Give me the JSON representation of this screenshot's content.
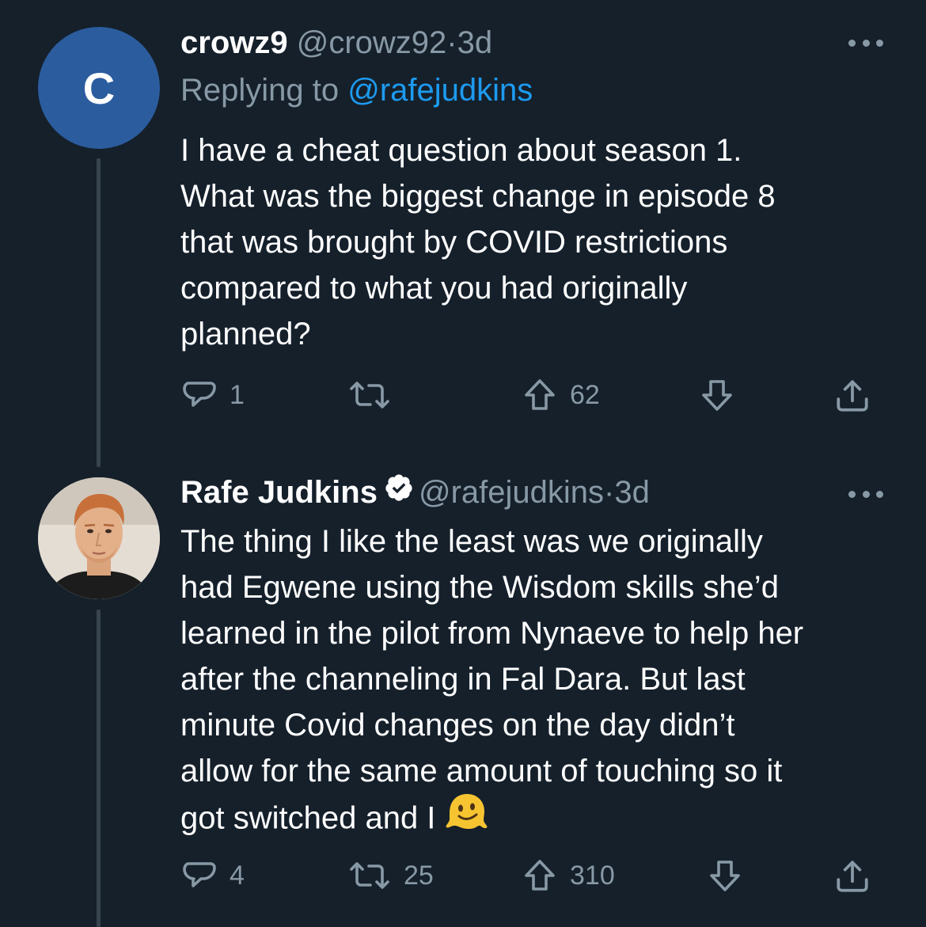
{
  "tweets": [
    {
      "avatar_letter": "C",
      "display_name": "crowz9",
      "handle": "@crowz92",
      "separator": "·",
      "time": "3d",
      "replying_prefix": "Replying to",
      "replying_to": "@rafejudkins",
      "lines": [
        "I have a cheat question about season 1.",
        "What was the biggest change in episode 8",
        "that was brought by COVID restrictions",
        "compared to what you had originally",
        "planned?"
      ],
      "actions": {
        "reply_count": "1",
        "retweet_count": "",
        "upvote_count": "62"
      }
    },
    {
      "display_name": "Rafe Judkins",
      "verified": true,
      "handle": "@rafejudkins",
      "separator": "·",
      "time": "3d",
      "lines": [
        "The thing I like the least was we originally",
        "had Egwene using the Wisdom skills she’d",
        "learned in the pilot from Nynaeve to help her",
        "after the channeling in Fal Dara.  But last",
        "minute Covid changes on the day didn’t",
        "allow for the same amount of touching so it",
        "got switched and I"
      ],
      "trailing_emoji": "melting-face-emoji",
      "actions": {
        "reply_count": "4",
        "retweet_count": "25",
        "upvote_count": "310"
      }
    }
  ],
  "colors": {
    "background": "#15202b",
    "text": "#ffffff",
    "secondary": "#8899a6",
    "link": "#1d9bf0",
    "avatar_bg": "#2b5c9e",
    "thread_line": "#38444d"
  },
  "icons": [
    "reply-icon",
    "retweet-icon",
    "upvote-icon",
    "downvote-icon",
    "share-icon",
    "more-icon",
    "verified-badge-icon"
  ]
}
